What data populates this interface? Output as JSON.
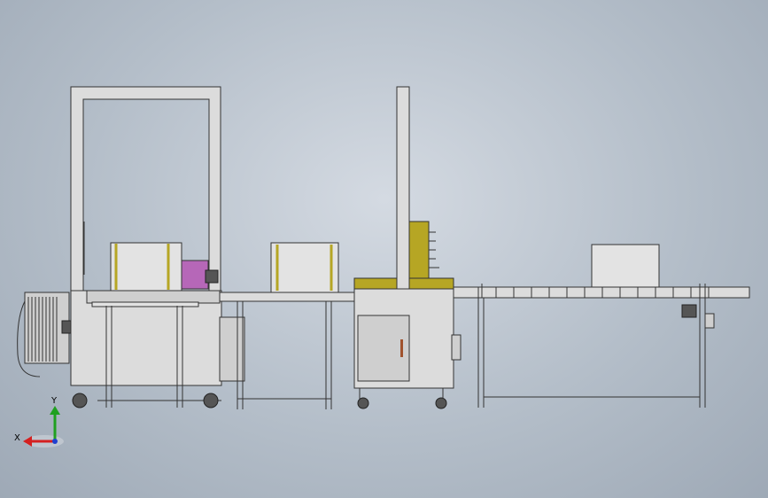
{
  "viewport": {
    "background_top": "#d4dae2",
    "background_bottom": "#9ea9b6"
  },
  "triad": {
    "x_label": "X",
    "y_label": "Y",
    "x_color": "#d42020",
    "y_color": "#20a020",
    "z_color": "#2040d0"
  },
  "colors": {
    "frame": "#dcdcdc",
    "olive_panel": "#b6a624",
    "pink_panel": "#b667b8",
    "box": "#e3e3e3"
  }
}
